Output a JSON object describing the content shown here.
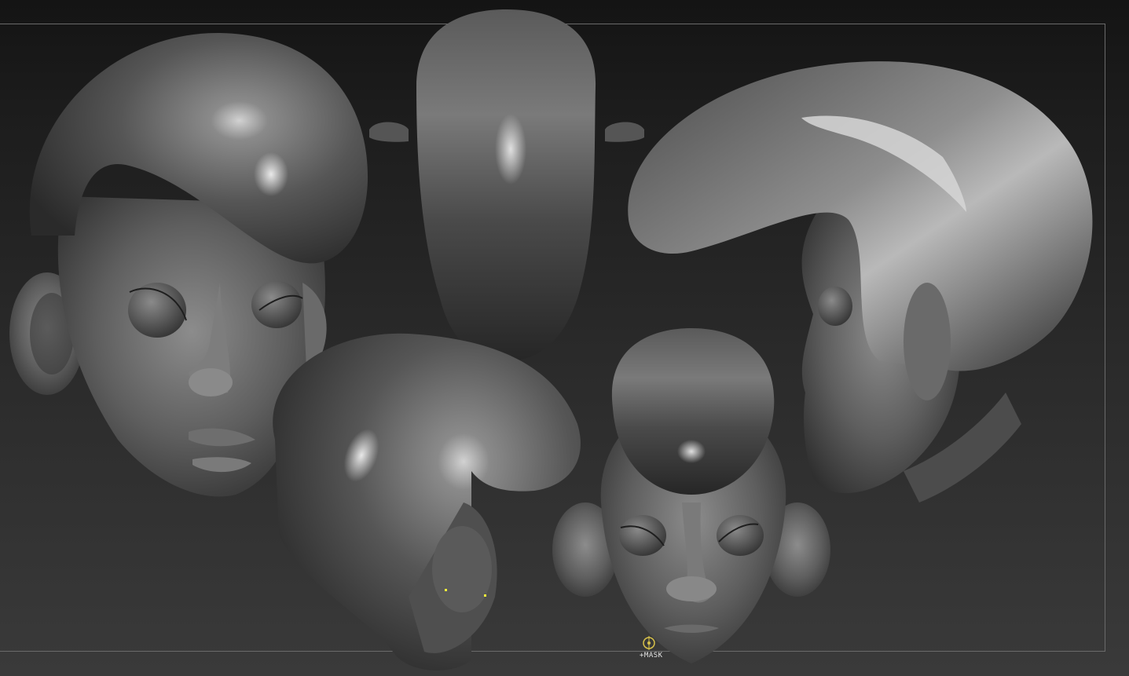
{
  "viewport": {
    "background_top": "#141414",
    "background_bottom": "#3a3a3a",
    "frame_color": "#6a6a6a"
  },
  "material": {
    "base": "#5a5a5a",
    "shadow": "#2e2e2e",
    "highlight": "#c8c8c8"
  },
  "cursor": {
    "label": "+MASK",
    "color": "#d8c24a",
    "icon": "brush-cursor-icon"
  },
  "models": [
    {
      "name": "head-view-front-left",
      "icon": "sculpt-head-icon"
    },
    {
      "name": "head-view-top",
      "icon": "sculpt-head-icon"
    },
    {
      "name": "head-view-right-profile",
      "icon": "sculpt-head-icon"
    },
    {
      "name": "head-view-back-left",
      "icon": "sculpt-head-icon"
    },
    {
      "name": "head-view-front",
      "icon": "sculpt-head-icon"
    }
  ]
}
